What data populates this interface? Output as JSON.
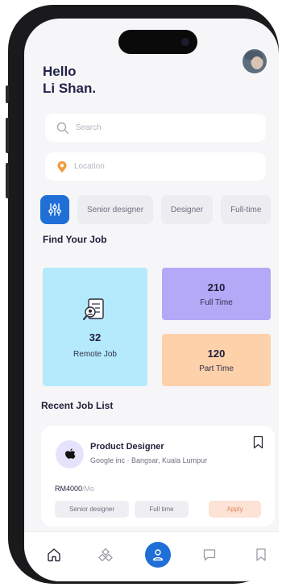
{
  "greeting": {
    "line1": "Hello",
    "line2": "Li Shan."
  },
  "search": {
    "placeholder": "Search"
  },
  "location": {
    "placeholder": "Location"
  },
  "chips": [
    "Senior designer",
    "Designer",
    "Full-time"
  ],
  "find_section": {
    "title": "Find Your Job",
    "remote": {
      "count": "32",
      "label": "Remote Job"
    },
    "full_time": {
      "count": "210",
      "label": "Full Time"
    },
    "part_time": {
      "count": "120",
      "label": "Part Time"
    }
  },
  "recent_section": {
    "title": "Recent Job List",
    "job": {
      "title": "Product Designer",
      "company_location": "Google inc · Bangsar, Kuala Lumpur",
      "salary": "RM4000",
      "salary_period": "/Mo",
      "tags": [
        "Senior designer",
        "Full time"
      ],
      "apply_label": "Apply"
    }
  },
  "colors": {
    "accent": "#1f6fd6",
    "remote_card": "#b4eafc",
    "full_time_card": "#b3a9f7",
    "part_time_card": "#fdd1aa",
    "apply": "#fde2d6"
  },
  "icons": {
    "filter": "sliders-icon",
    "company": "apple-logo-icon",
    "tabs": [
      "home-icon",
      "explore-icon",
      "profile-icon",
      "messages-icon",
      "bookmark-icon"
    ]
  }
}
